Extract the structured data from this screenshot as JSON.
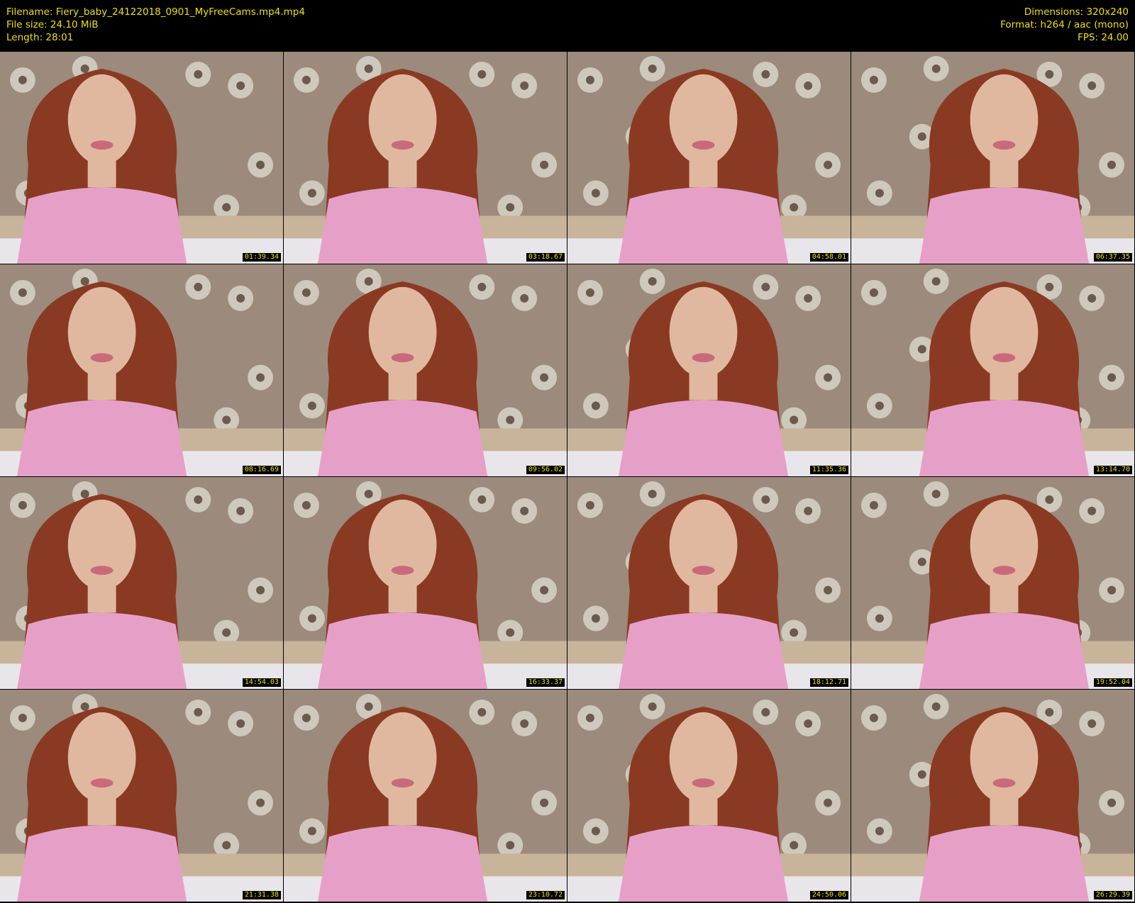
{
  "meta": {
    "filename": "Filename: Fiery_baby_24122018_0901_MyFreeCams.mp4.mp4",
    "filesize": "File size: 24.10 MiB",
    "length": "Length: 28:01",
    "dimensions": "Dimensions: 320x240",
    "format": "Format: h264 / aac (mono)",
    "fps": "FPS: 24.00"
  },
  "colors": {
    "background": "#000000",
    "text": "#f0e000",
    "wallpaper": "#9c8a7c",
    "shirt": "#e6a0c8",
    "hair": "#8a3a22",
    "skin": "#e0b8a0"
  },
  "thumbnails": [
    {
      "time": "01:39.34"
    },
    {
      "time": "03:18.67"
    },
    {
      "time": "04:58.01"
    },
    {
      "time": "06:37.35"
    },
    {
      "time": "08:16.69"
    },
    {
      "time": "09:56.02"
    },
    {
      "time": "11:35.36"
    },
    {
      "time": "13:14.70"
    },
    {
      "time": "14:54.03"
    },
    {
      "time": "16:33.37"
    },
    {
      "time": "18:12.71"
    },
    {
      "time": "19:52.04"
    },
    {
      "time": "21:31.38"
    },
    {
      "time": "23:10.72"
    },
    {
      "time": "24:50.06"
    },
    {
      "time": "26:29.39"
    }
  ]
}
